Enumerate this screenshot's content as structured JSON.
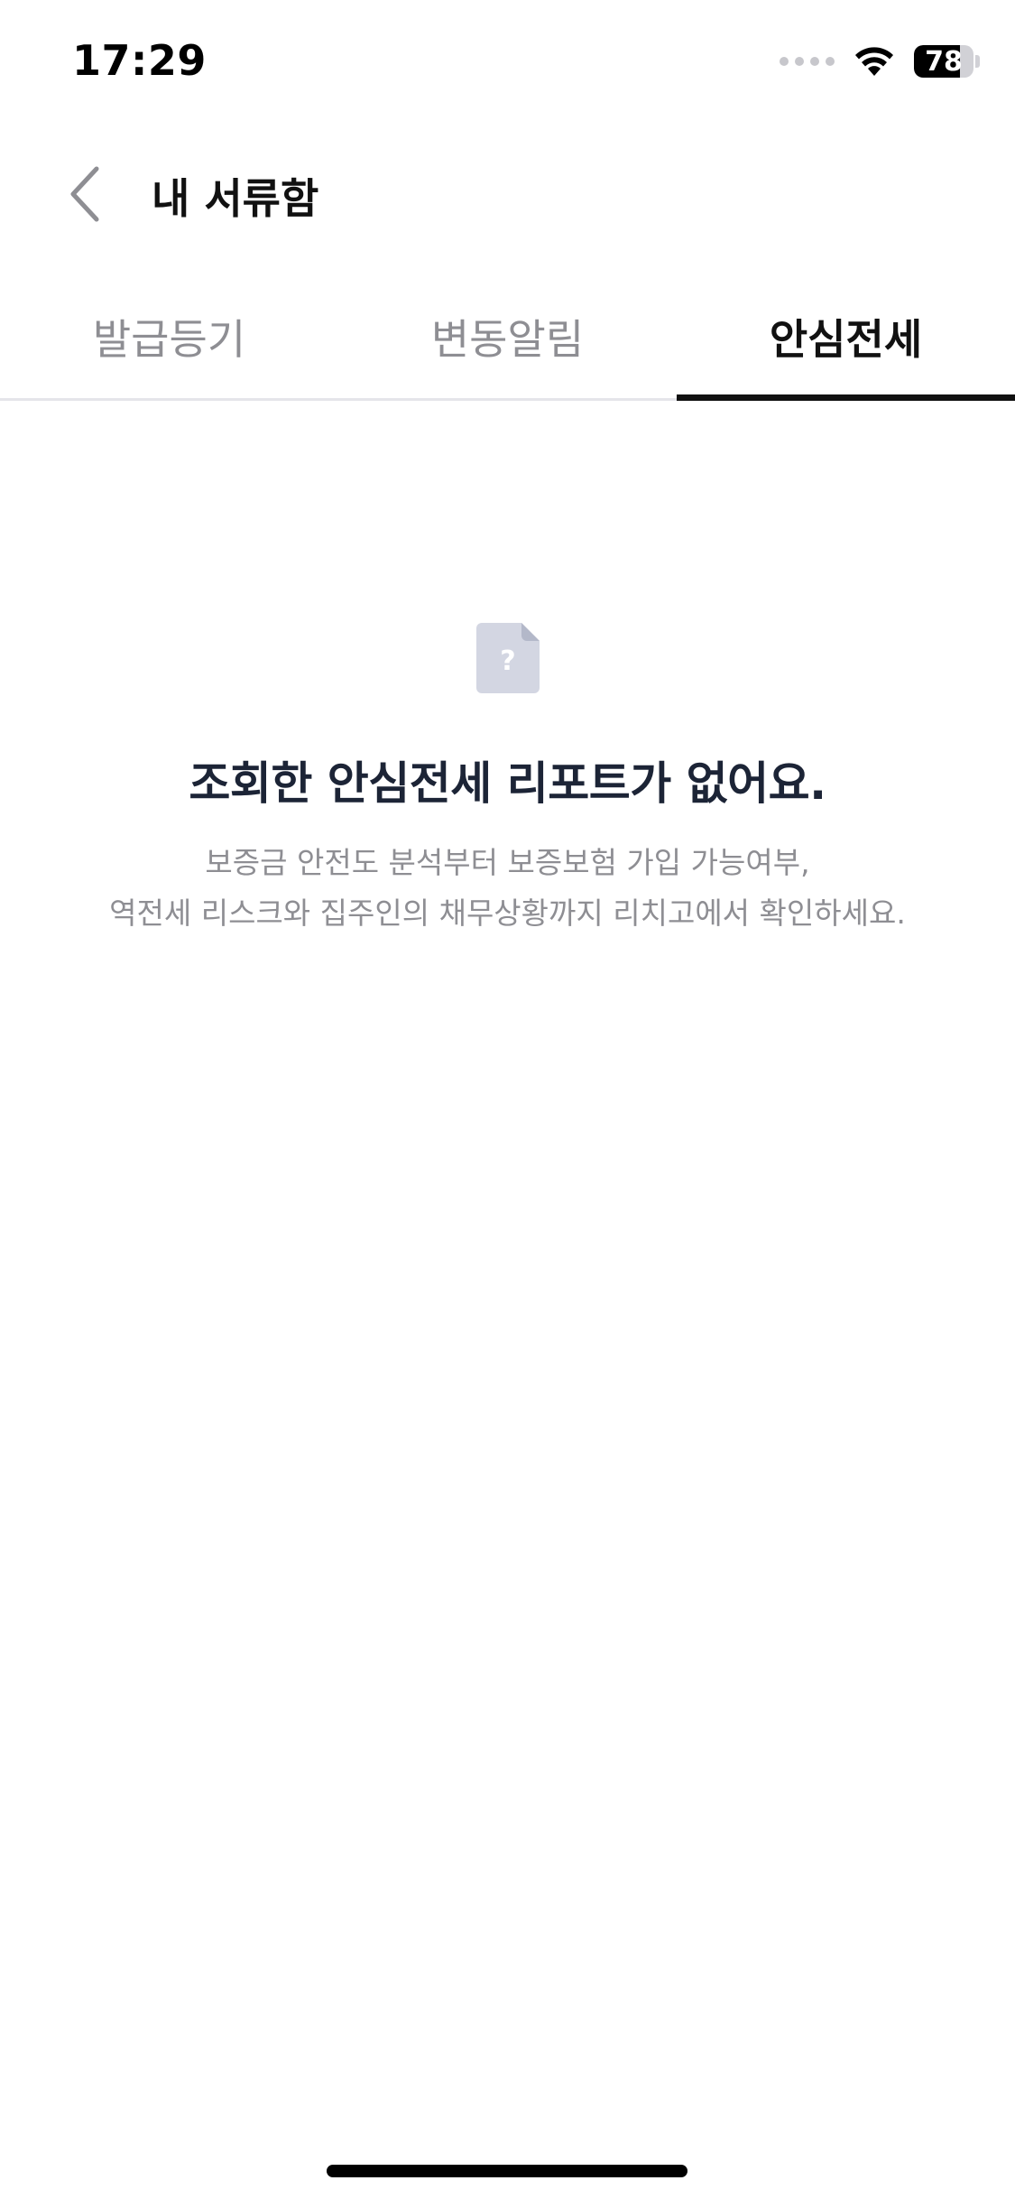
{
  "status_bar": {
    "time": "17:29",
    "battery_percent": 78,
    "battery_label": "78"
  },
  "header": {
    "back_icon": "chevron-left-icon",
    "title": "내 서류함"
  },
  "tabs": [
    {
      "label": "발급등기",
      "active": false
    },
    {
      "label": "변동알림",
      "active": false
    },
    {
      "label": "안심전세",
      "active": true
    }
  ],
  "empty_state": {
    "icon": "document-question-icon",
    "title": "조회한 안심전세 리포트가 없어요.",
    "description_line1": "보증금 안전도 분석부터 보증보험 가입 가능여부,",
    "description_line2": "역전세 리스크와 집주인의 채무상황까지 리치고에서 확인하세요."
  },
  "colors": {
    "accent": "#111111",
    "inactive_tab": "#8e8e93",
    "title_text": "#1c2436",
    "icon_fill": "#d3d6e2"
  }
}
